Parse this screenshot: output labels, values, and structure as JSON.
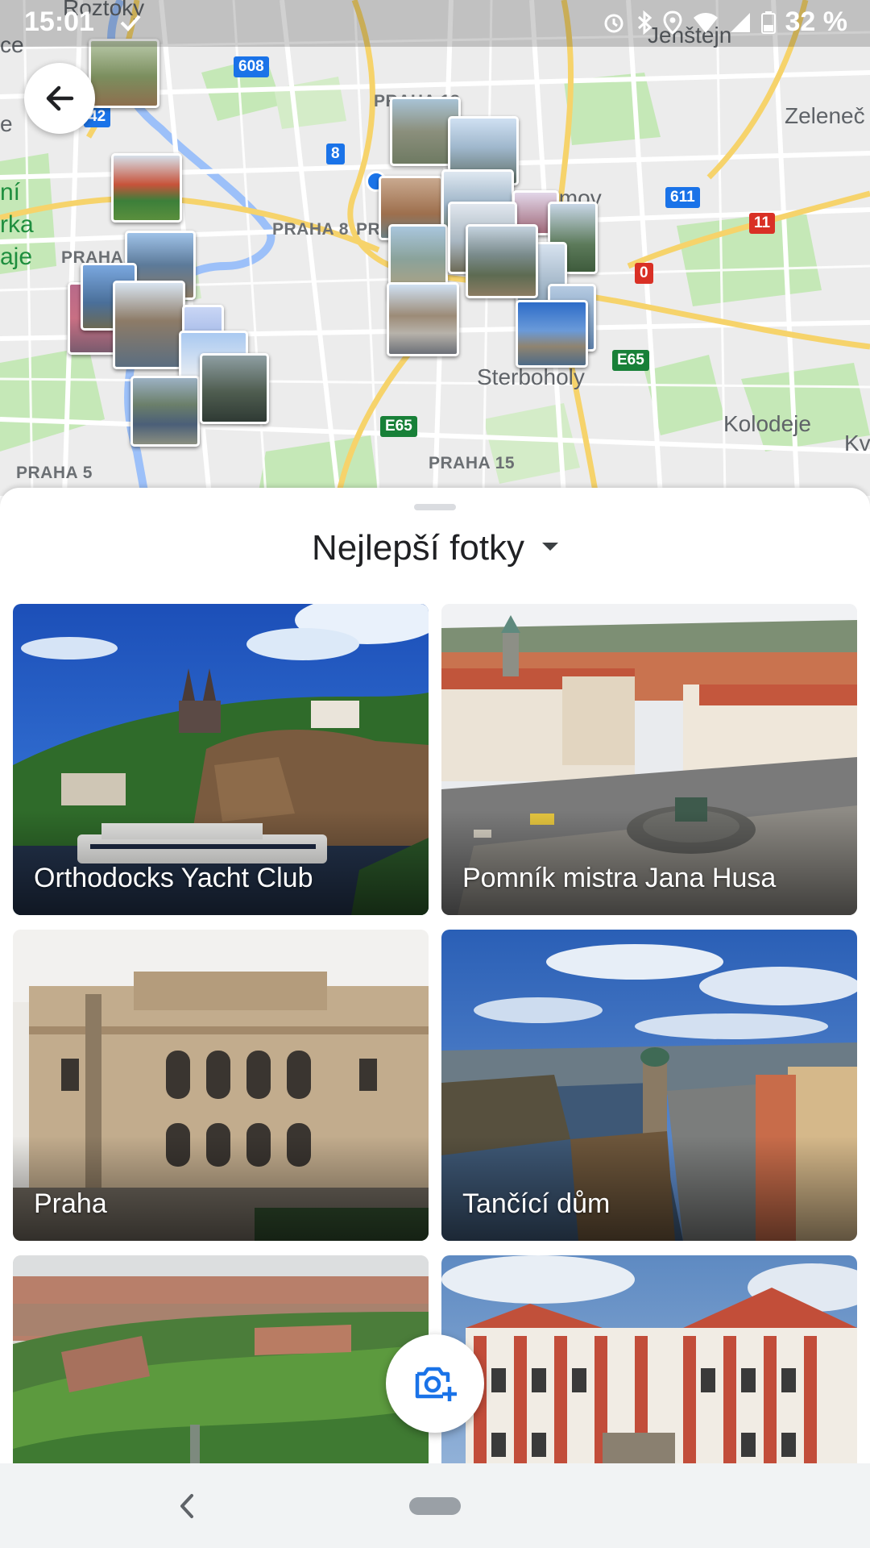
{
  "status_bar": {
    "time": "15:01",
    "battery": "32 %"
  },
  "map": {
    "places": [
      {
        "id": "poztoky",
        "text": "Roztoky"
      },
      {
        "id": "jenstejn",
        "text": "Jenštejn"
      },
      {
        "id": "zelenec",
        "text": "Zeleneč"
      },
      {
        "id": "praha18",
        "text": "PRAHA 18"
      },
      {
        "id": "praha8",
        "text": "PRAHA 8"
      },
      {
        "id": "praha8b",
        "text": "PR"
      },
      {
        "id": "praha_w",
        "text": "PRAHA"
      },
      {
        "id": "domov",
        "text": "Domov"
      },
      {
        "id": "sterboholy",
        "text": "Sterboholy"
      },
      {
        "id": "kolodeje",
        "text": "Kolodeje"
      },
      {
        "id": "kv",
        "text": "Kv"
      },
      {
        "id": "praha15",
        "text": "PRAHA 15"
      },
      {
        "id": "praha5",
        "text": "PRAHA 5"
      },
      {
        "id": "ce",
        "text": "ce"
      },
      {
        "id": "e",
        "text": "e"
      },
      {
        "id": "park1",
        "text": "ní"
      },
      {
        "id": "park2",
        "text": "rka"
      },
      {
        "id": "park3",
        "text": "aje"
      }
    ],
    "shields": [
      {
        "id": "r608",
        "text": "608"
      },
      {
        "id": "r8",
        "text": "8"
      },
      {
        "id": "r611",
        "text": "611"
      },
      {
        "id": "r11",
        "text": "11"
      },
      {
        "id": "r0",
        "text": "0"
      },
      {
        "id": "e65a",
        "text": "E65"
      },
      {
        "id": "e65b",
        "text": "E65"
      },
      {
        "id": "r42",
        "text": "42"
      }
    ]
  },
  "sheet": {
    "title": "Nejlepší fotky",
    "cards": [
      {
        "caption": "Orthodocks Yacht Club"
      },
      {
        "caption": "Pomník mistra Jana Husa"
      },
      {
        "caption": "Praha"
      },
      {
        "caption": "Tančící dům"
      },
      {
        "caption": ""
      },
      {
        "caption": ""
      }
    ]
  },
  "icons": {
    "back": "arrow-back-icon",
    "camera": "add-photo-icon",
    "nav_back": "chevron-left-icon",
    "nav_home": "home-pill"
  },
  "colors": {
    "map_background": "#ececec",
    "road": "#ffffff",
    "highway": "#f6d36b",
    "park": "#c5e8b7",
    "water": "#9cc0f9",
    "accent": "#1a73e8"
  }
}
